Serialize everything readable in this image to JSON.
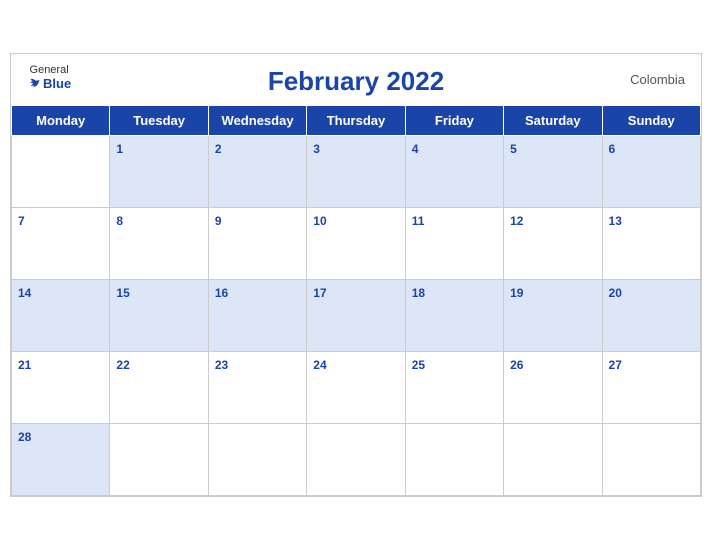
{
  "header": {
    "title": "February 2022",
    "country": "Colombia",
    "logo": {
      "general": "General",
      "blue": "Blue"
    }
  },
  "weekdays": [
    "Monday",
    "Tuesday",
    "Wednesday",
    "Thursday",
    "Friday",
    "Saturday",
    "Sunday"
  ],
  "weeks": [
    [
      null,
      1,
      2,
      3,
      4,
      5,
      6
    ],
    [
      7,
      8,
      9,
      10,
      11,
      12,
      13
    ],
    [
      14,
      15,
      16,
      17,
      18,
      19,
      20
    ],
    [
      21,
      22,
      23,
      24,
      25,
      26,
      27
    ],
    [
      28,
      null,
      null,
      null,
      null,
      null,
      null
    ]
  ]
}
